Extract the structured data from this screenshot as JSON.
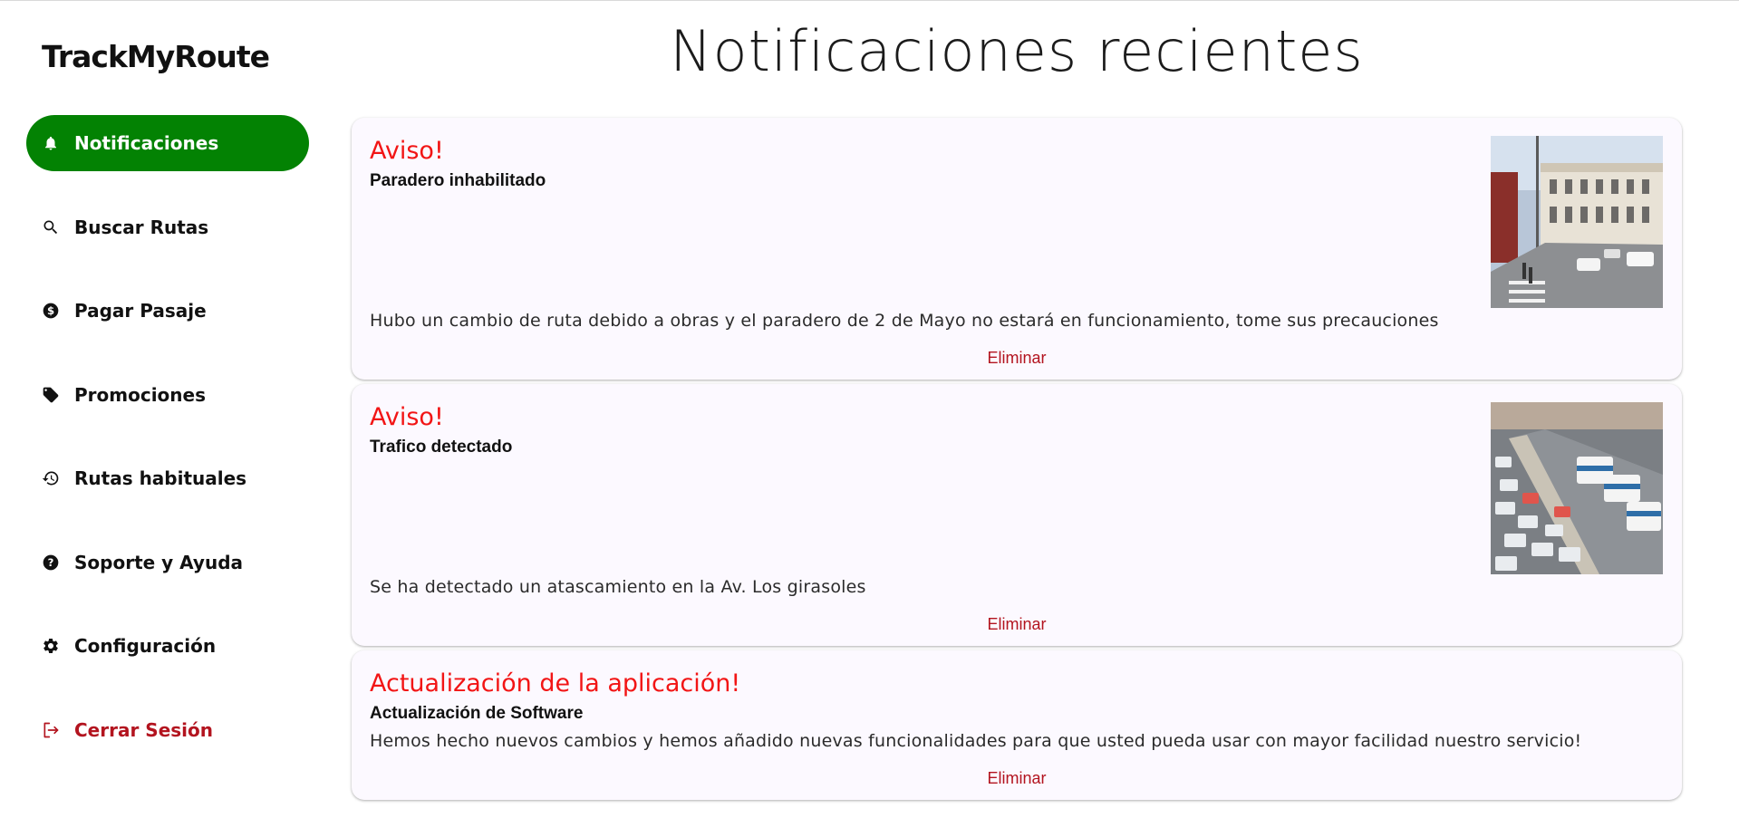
{
  "app": {
    "logo": "TrackMyRoute"
  },
  "sidebar": {
    "items": [
      {
        "label": "Notificaciones",
        "icon": "bell-icon",
        "active": true
      },
      {
        "label": "Buscar Rutas",
        "icon": "search-icon"
      },
      {
        "label": "Pagar Pasaje",
        "icon": "dollar-circle-icon"
      },
      {
        "label": "Promociones",
        "icon": "tag-icon"
      },
      {
        "label": "Rutas habituales",
        "icon": "history-icon"
      },
      {
        "label": "Soporte y Ayuda",
        "icon": "help-circle-icon"
      },
      {
        "label": "Configuración",
        "icon": "gear-icon"
      },
      {
        "label": "Cerrar Sesión",
        "icon": "logout-icon"
      }
    ],
    "active_color": "#038203",
    "logout_color": "#b3141f"
  },
  "main": {
    "title": "Notificaciones recientes",
    "notifications": [
      {
        "title": "Aviso!",
        "subtitle": "Paradero inhabilitado",
        "text": "Hubo un cambio de ruta debido a obras y el paradero de 2 de Mayo no estará en funcionamiento, tome sus precauciones",
        "delete_label": "Eliminar",
        "image": "street-photo"
      },
      {
        "title": "Aviso!",
        "subtitle": "Trafico detectado",
        "text": "Se ha detectado un atascamiento en la Av. Los girasoles",
        "delete_label": "Eliminar",
        "image": "traffic-photo"
      },
      {
        "title": "Actualización de la aplicación!",
        "subtitle": "Actualización de Software",
        "text": "Hemos hecho nuevos cambios y hemos añadido nuevas funcionalidades para que usted pueda usar con mayor facilidad nuestro servicio!",
        "delete_label": "Eliminar"
      }
    ],
    "title_color": "#f21515",
    "card_bg": "#fcf9ff"
  }
}
